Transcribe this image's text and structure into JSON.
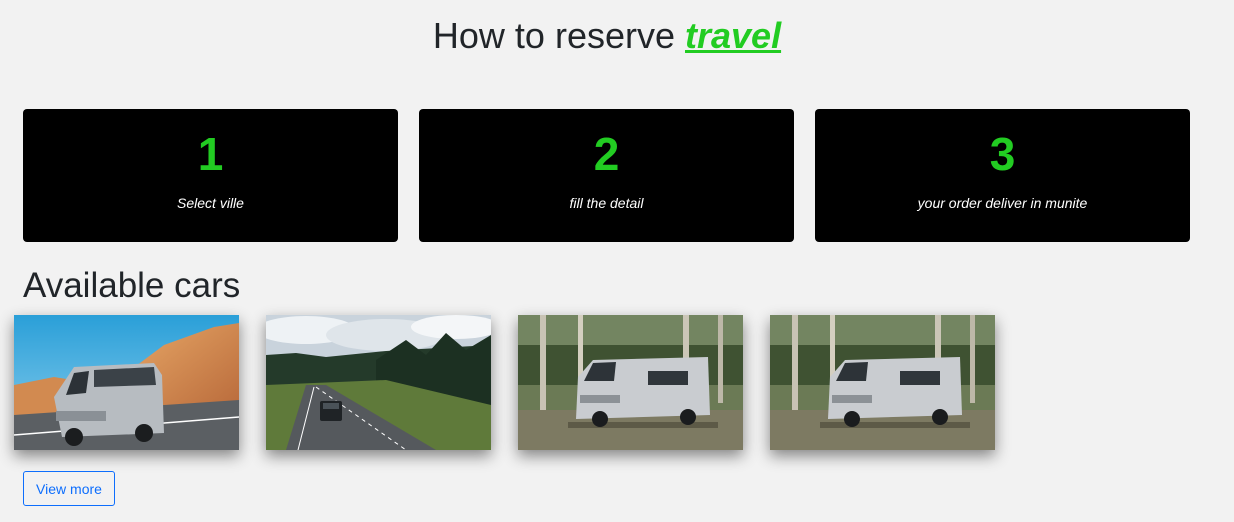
{
  "header": {
    "title_prefix": "How to reserve ",
    "brand": "travel",
    "brand_color": "#22cc22"
  },
  "steps": [
    {
      "number": "1",
      "text": "Select ville"
    },
    {
      "number": "2",
      "text": "fill the detail"
    },
    {
      "number": "3",
      "text": "your order deliver in munite"
    }
  ],
  "cars_section": {
    "title": "Available cars",
    "images": [
      {
        "name": "van-desert-road-photo"
      },
      {
        "name": "van-forest-road-photo"
      },
      {
        "name": "camper-van-forest-photo"
      },
      {
        "name": "camper-van-forest-photo"
      }
    ],
    "view_more_label": "View more"
  },
  "colors": {
    "background": "#f2f2f2",
    "card_background": "#000000",
    "accent_green": "#22cc22",
    "button_blue": "#0d6efd"
  }
}
